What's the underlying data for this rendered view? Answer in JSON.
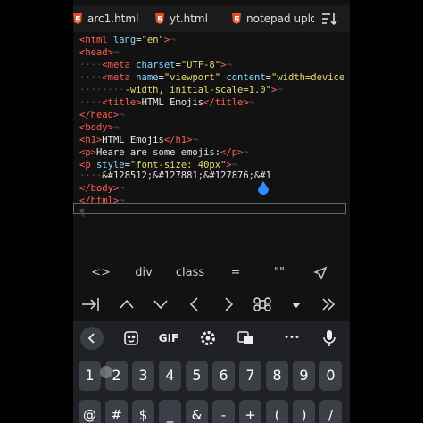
{
  "tabs": [
    {
      "label": "arc1.html"
    },
    {
      "label": "yt.html"
    },
    {
      "label": "notepad uploa"
    }
  ],
  "editor": {
    "lines": [
      {
        "segments": [
          "<",
          "html",
          " ",
          "lang",
          "=",
          "\"en\"",
          ">",
          "¬"
        ]
      },
      {
        "text": "<head>¬"
      },
      {
        "text": "····<meta charset=\"UTF-8\">¬"
      },
      {
        "text": "····<meta name=\"viewport\" content=\"width=device"
      },
      {
        "text": "········-width, initial-scale=1.0\">¬"
      },
      {
        "text": "····<title>HTML Emojis</title>¬"
      },
      {
        "text": "</head>¬"
      },
      {
        "text": "<body>¬"
      },
      {
        "text": "<h1>HTML Emojis</h1>¬"
      },
      {
        "text": "<p>Heare are some emojis:</p>¬"
      },
      {
        "text": "<p style=\"font-size: 40px\">¬"
      },
      {
        "text": "····&#128512;&#127881;&#127876;&#1"
      },
      {
        "text": "</body>¬"
      },
      {
        "text": "</html>¬"
      },
      {
        "text": "¶"
      }
    ]
  },
  "quickbar": {
    "items": [
      "<>",
      "div",
      "class",
      "=",
      "\"\"",
      "send"
    ]
  },
  "keyboard": {
    "toolbar": [
      "back-icon",
      "sticker-icon",
      "GIF",
      "settings-icon",
      "translate-icon",
      "more-icon",
      "mic-icon"
    ],
    "gif_label": "GIF",
    "more_label": "•••",
    "numbers": [
      "1",
      "2",
      "3",
      "4",
      "5",
      "6",
      "7",
      "8",
      "9",
      "0"
    ],
    "symbols": [
      "@",
      "#",
      "$",
      "_",
      "&",
      "-",
      "+",
      "(",
      ")",
      "/"
    ]
  },
  "colors": {
    "tag": "#ff5f56",
    "attribute": "#8fd3ff",
    "string": "#e6db74",
    "whitespace_marker": "#555555",
    "caret": "#2f8cff"
  }
}
